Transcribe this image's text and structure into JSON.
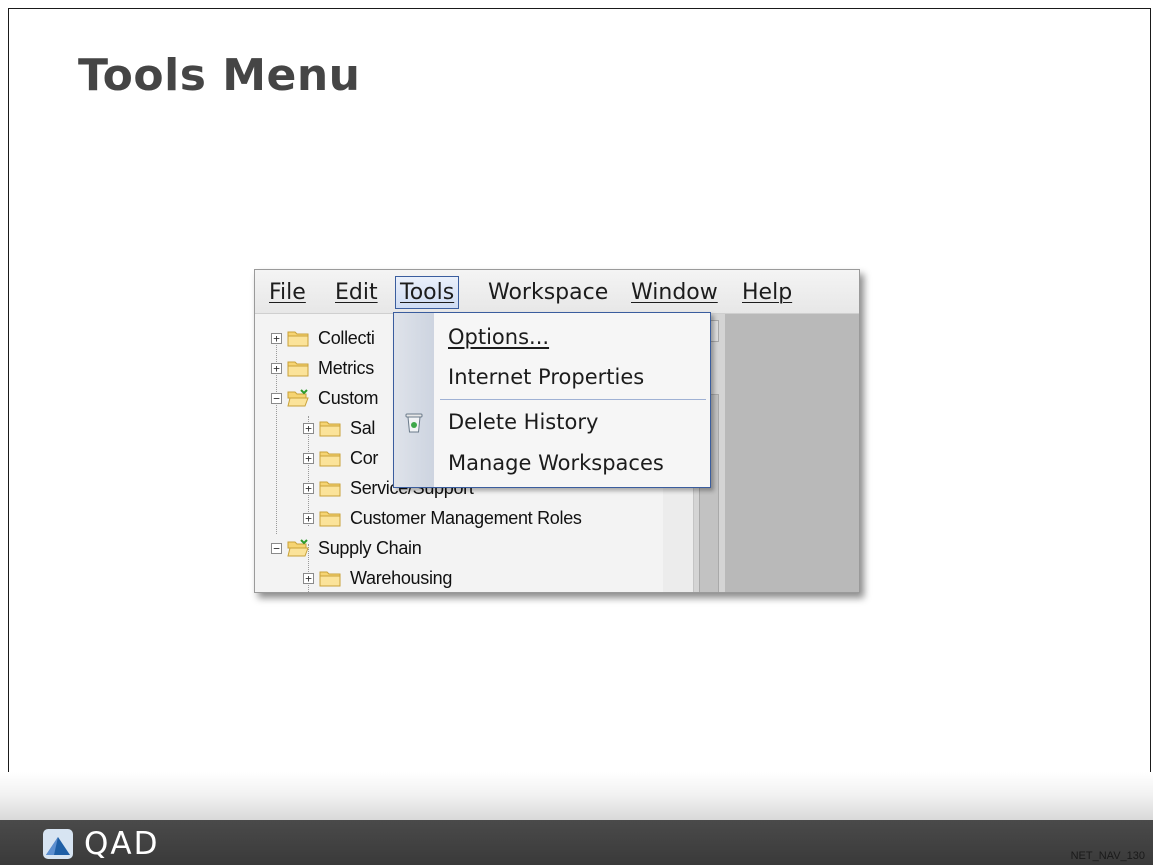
{
  "slide": {
    "title": "Tools Menu",
    "footer_logo_text": "QAD",
    "slide_code": "NET_NAV_130"
  },
  "menubar": {
    "items": [
      {
        "label": "File"
      },
      {
        "label": "Edit"
      },
      {
        "label": "Tools",
        "active": true
      },
      {
        "label": "Workspace"
      },
      {
        "label": "Window"
      },
      {
        "label": "Help"
      }
    ]
  },
  "tools_menu": {
    "items": [
      {
        "label": "Options..."
      },
      {
        "label": "Internet Properties"
      },
      {
        "label": "Delete History",
        "icon": "trash-icon"
      },
      {
        "label": "Manage Workspaces"
      }
    ]
  },
  "tree": {
    "items": [
      {
        "label": "Collecti",
        "state": "collapsed",
        "level": 0
      },
      {
        "label": "Metrics",
        "state": "collapsed",
        "level": 0
      },
      {
        "label": "Custom",
        "state": "expanded",
        "level": 0
      },
      {
        "label": "Sal",
        "state": "collapsed",
        "level": 1
      },
      {
        "label": "Cor",
        "state": "collapsed",
        "level": 1
      },
      {
        "label": "Service/Support",
        "state": "collapsed",
        "level": 1
      },
      {
        "label": "Customer Management Roles",
        "state": "collapsed",
        "level": 1
      },
      {
        "label": "Supply Chain",
        "state": "expanded",
        "level": 0
      },
      {
        "label": "Warehousing",
        "state": "collapsed",
        "level": 1
      }
    ]
  },
  "colors": {
    "menu_highlight_border": "#3a5d9e",
    "footer_bar": "#3d3d3d",
    "title": "#454545"
  }
}
